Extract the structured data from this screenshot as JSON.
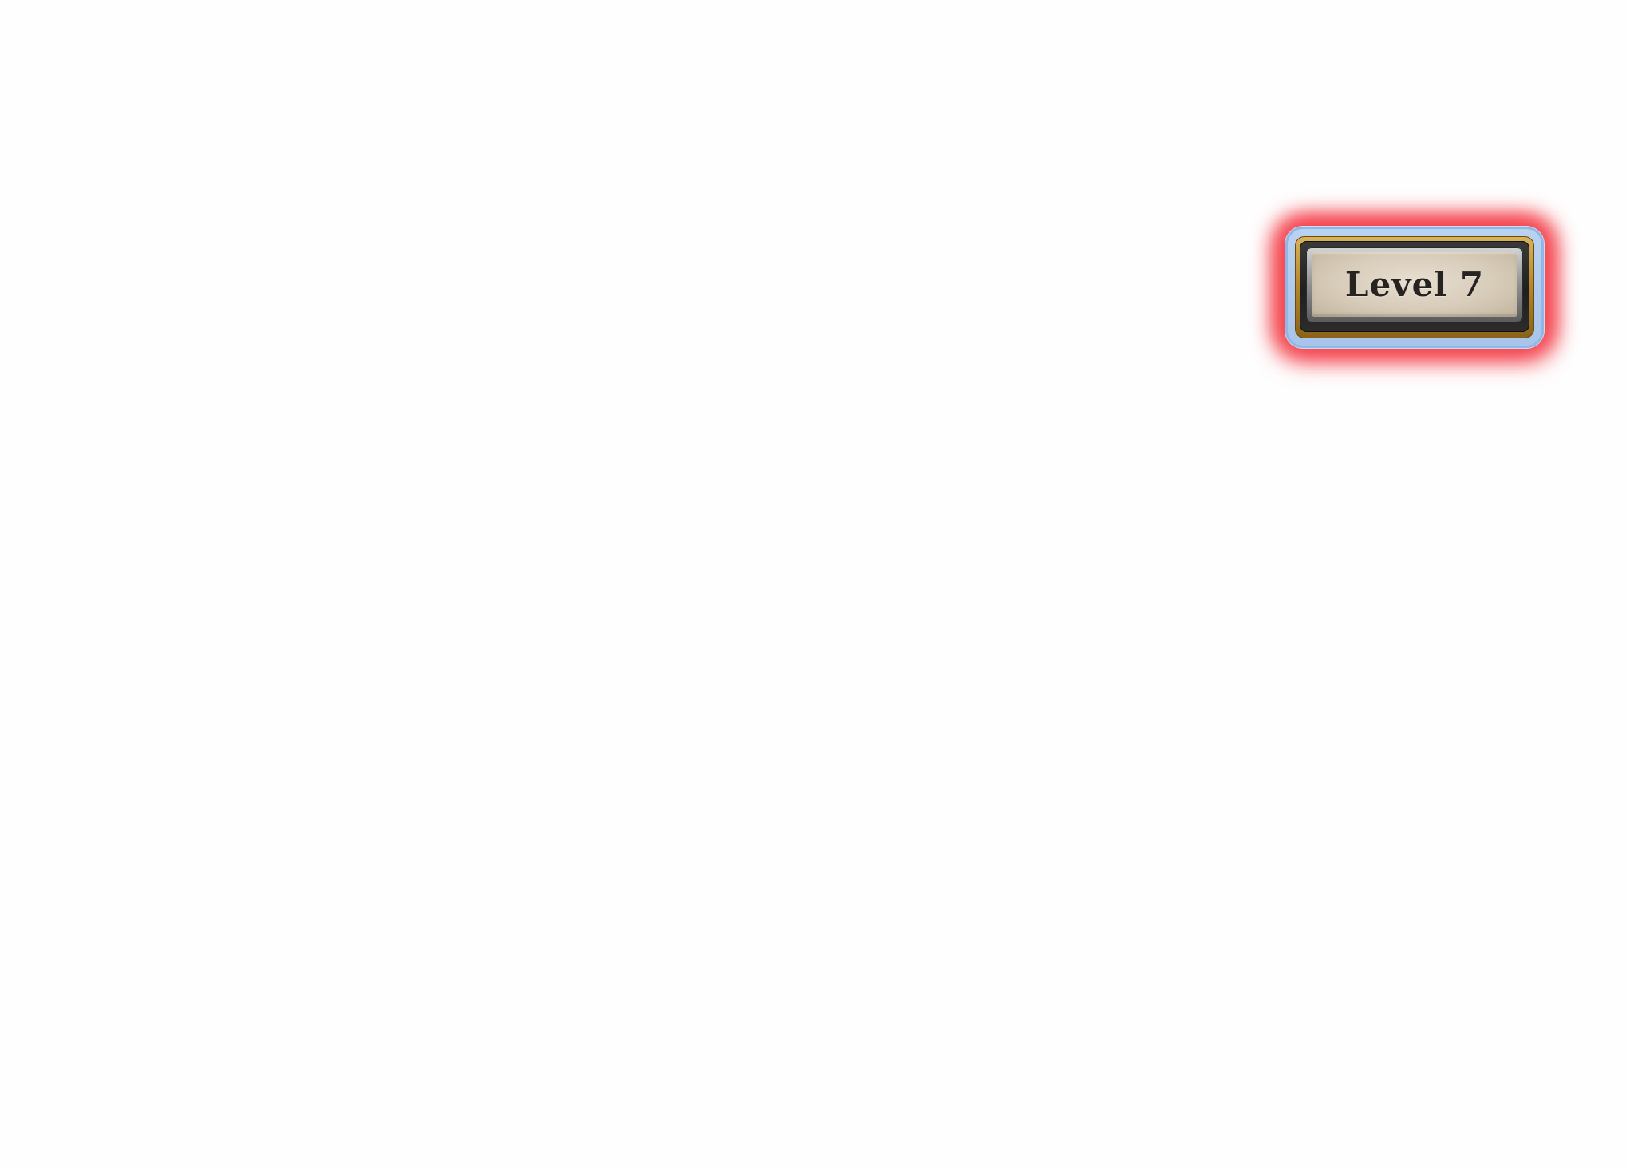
{
  "hud": {
    "level_badge": {
      "label": "Level 7",
      "glow_color": "#f53c46",
      "frame_color": "#b88a2c",
      "plate_color": "#d6cab7"
    }
  }
}
